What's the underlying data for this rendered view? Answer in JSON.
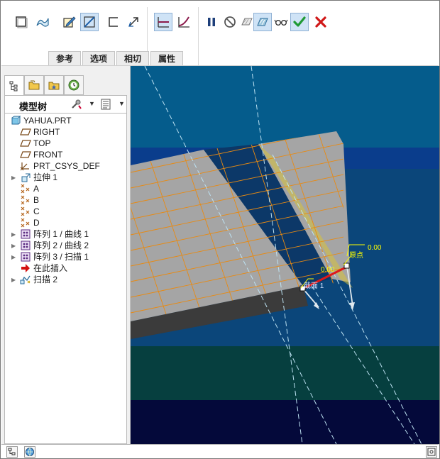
{
  "toolbar": {
    "buttons": [
      {
        "name": "solid-icon"
      },
      {
        "name": "surface-icon"
      },
      {
        "name": "sketch-edit-icon"
      },
      {
        "name": "section-plane-icon"
      },
      {
        "name": "thin-open-icon"
      },
      {
        "name": "direction-flip-icon"
      },
      {
        "name": "constant-section-icon"
      },
      {
        "name": "variable-section-icon"
      },
      {
        "name": "pause-icon"
      },
      {
        "name": "no-preview-icon"
      },
      {
        "name": "preview-icon"
      },
      {
        "name": "verify-mode-icon"
      },
      {
        "name": "glasses-icon"
      },
      {
        "name": "confirm-check-icon"
      },
      {
        "name": "cancel-x-icon"
      }
    ],
    "tabs": [
      "参考",
      "选项",
      "相切",
      "属性"
    ]
  },
  "left_panel": {
    "title": "模型树",
    "tree": [
      {
        "label": "YAHUA.PRT",
        "icon": "part-icon",
        "expander": false,
        "indent": 0
      },
      {
        "label": "RIGHT",
        "icon": "datum-plane-icon",
        "expander": false,
        "indent": 1
      },
      {
        "label": "TOP",
        "icon": "datum-plane-icon",
        "expander": false,
        "indent": 1
      },
      {
        "label": "FRONT",
        "icon": "datum-plane-icon",
        "expander": false,
        "indent": 1
      },
      {
        "label": "PRT_CSYS_DEF",
        "icon": "csys-icon",
        "expander": false,
        "indent": 1
      },
      {
        "label": "拉伸 1",
        "icon": "extrude-icon",
        "expander": true,
        "indent": 1
      },
      {
        "label": "A",
        "icon": "datum-point-icon",
        "expander": false,
        "indent": 1
      },
      {
        "label": "B",
        "icon": "datum-point-icon",
        "expander": false,
        "indent": 1
      },
      {
        "label": "C",
        "icon": "datum-point-icon",
        "expander": false,
        "indent": 1
      },
      {
        "label": "D",
        "icon": "datum-point-icon",
        "expander": false,
        "indent": 1
      },
      {
        "label": "阵列 1 / 曲线 1",
        "icon": "pattern-icon",
        "expander": true,
        "indent": 1
      },
      {
        "label": "阵列 2 / 曲线 2",
        "icon": "pattern-icon",
        "expander": true,
        "indent": 1
      },
      {
        "label": "阵列 3 / 扫描 1",
        "icon": "pattern-icon",
        "expander": true,
        "indent": 1
      },
      {
        "label": "在此插入",
        "icon": "insert-here-icon",
        "expander": false,
        "indent": 1
      },
      {
        "label": "扫描 2",
        "icon": "sweep-icon",
        "expander": true,
        "indent": 1
      }
    ]
  },
  "viewport": {
    "dimension_1": "0.00",
    "dimension_2": "0.00",
    "origin_label": "原点",
    "section_label": "截面 1"
  }
}
